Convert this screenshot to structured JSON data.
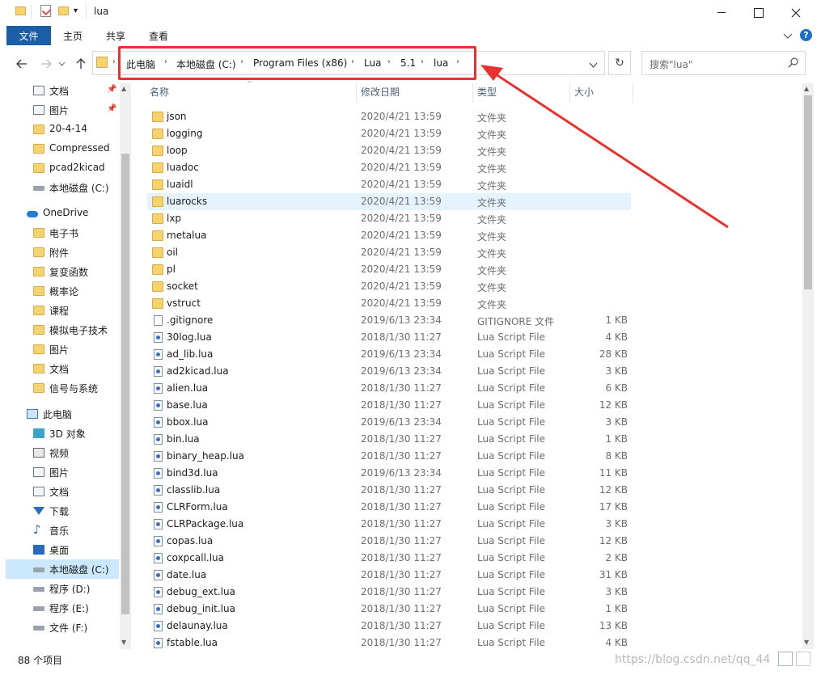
{
  "window": {
    "title": "lua",
    "qat_dropdown": "▾"
  },
  "ribbon": {
    "tabs": [
      "文件",
      "主页",
      "共享",
      "查看"
    ]
  },
  "address": {
    "crumbs": [
      "此电脑",
      "本地磁盘 (C:)",
      "Program Files (x86)",
      "Lua",
      "5.1",
      "lua"
    ]
  },
  "search": {
    "placeholder": "搜索\"lua\""
  },
  "nav": {
    "items": [
      {
        "label": "文档",
        "icon": "documents-icon",
        "pinned": true
      },
      {
        "label": "图片",
        "icon": "pictures-icon",
        "pinned": true
      },
      {
        "label": "20-4-14",
        "icon": "folder-icon"
      },
      {
        "label": "Compressed",
        "icon": "folder-icon"
      },
      {
        "label": "pcad2kicad",
        "icon": "folder-icon"
      },
      {
        "label": "本地磁盘 (C:)",
        "icon": "drive-icon"
      },
      {
        "label": "OneDrive",
        "icon": "cloud-icon"
      },
      {
        "label": "电子书",
        "icon": "folder-icon"
      },
      {
        "label": "附件",
        "icon": "folder-icon"
      },
      {
        "label": "复变函数",
        "icon": "folder-icon"
      },
      {
        "label": "概率论",
        "icon": "folder-icon"
      },
      {
        "label": "课程",
        "icon": "folder-icon"
      },
      {
        "label": "模拟电子技术",
        "icon": "folder-icon"
      },
      {
        "label": "图片",
        "icon": "folder-icon"
      },
      {
        "label": "文档",
        "icon": "folder-icon"
      },
      {
        "label": "信号与系统",
        "icon": "folder-icon"
      },
      {
        "label": "此电脑",
        "icon": "computer-icon"
      },
      {
        "label": "3D 对象",
        "icon": "3d-objects-icon"
      },
      {
        "label": "视频",
        "icon": "video-icon"
      },
      {
        "label": "图片",
        "icon": "pictures-icon"
      },
      {
        "label": "文档",
        "icon": "documents-icon"
      },
      {
        "label": "下载",
        "icon": "download-icon"
      },
      {
        "label": "音乐",
        "icon": "music-icon"
      },
      {
        "label": "桌面",
        "icon": "desktop-icon"
      },
      {
        "label": "本地磁盘 (C:)",
        "icon": "drive-icon",
        "selected": true
      },
      {
        "label": "程序 (D:)",
        "icon": "drive-icon"
      },
      {
        "label": "程序 (E:)",
        "icon": "drive-icon"
      },
      {
        "label": "文件 (F:)",
        "icon": "drive-icon"
      }
    ]
  },
  "columns": {
    "name": "名称",
    "date": "修改日期",
    "type": "类型",
    "size": "大小"
  },
  "files": [
    {
      "name": "json",
      "date": "2020/4/21 13:59",
      "type": "文件夹",
      "size": "",
      "kind": "folder"
    },
    {
      "name": "logging",
      "date": "2020/4/21 13:59",
      "type": "文件夹",
      "size": "",
      "kind": "folder"
    },
    {
      "name": "loop",
      "date": "2020/4/21 13:59",
      "type": "文件夹",
      "size": "",
      "kind": "folder"
    },
    {
      "name": "luadoc",
      "date": "2020/4/21 13:59",
      "type": "文件夹",
      "size": "",
      "kind": "folder"
    },
    {
      "name": "luaidl",
      "date": "2020/4/21 13:59",
      "type": "文件夹",
      "size": "",
      "kind": "folder"
    },
    {
      "name": "luarocks",
      "date": "2020/4/21 13:59",
      "type": "文件夹",
      "size": "",
      "kind": "folder",
      "selected": true
    },
    {
      "name": "lxp",
      "date": "2020/4/21 13:59",
      "type": "文件夹",
      "size": "",
      "kind": "folder"
    },
    {
      "name": "metalua",
      "date": "2020/4/21 13:59",
      "type": "文件夹",
      "size": "",
      "kind": "folder"
    },
    {
      "name": "oil",
      "date": "2020/4/21 13:59",
      "type": "文件夹",
      "size": "",
      "kind": "folder"
    },
    {
      "name": "pl",
      "date": "2020/4/21 13:59",
      "type": "文件夹",
      "size": "",
      "kind": "folder"
    },
    {
      "name": "socket",
      "date": "2020/4/21 13:59",
      "type": "文件夹",
      "size": "",
      "kind": "folder"
    },
    {
      "name": "vstruct",
      "date": "2020/4/21 13:59",
      "type": "文件夹",
      "size": "",
      "kind": "folder"
    },
    {
      "name": ".gitignore",
      "date": "2019/6/13 23:34",
      "type": "GITIGNORE 文件",
      "size": "1 KB",
      "kind": "file"
    },
    {
      "name": "30log.lua",
      "date": "2018/1/30 11:27",
      "type": "Lua Script File",
      "size": "4 KB",
      "kind": "lua"
    },
    {
      "name": "ad_lib.lua",
      "date": "2019/6/13 23:34",
      "type": "Lua Script File",
      "size": "28 KB",
      "kind": "lua"
    },
    {
      "name": "ad2kicad.lua",
      "date": "2019/6/13 23:34",
      "type": "Lua Script File",
      "size": "3 KB",
      "kind": "lua"
    },
    {
      "name": "alien.lua",
      "date": "2018/1/30 11:27",
      "type": "Lua Script File",
      "size": "6 KB",
      "kind": "lua"
    },
    {
      "name": "base.lua",
      "date": "2018/1/30 11:27",
      "type": "Lua Script File",
      "size": "12 KB",
      "kind": "lua"
    },
    {
      "name": "bbox.lua",
      "date": "2019/6/13 23:34",
      "type": "Lua Script File",
      "size": "3 KB",
      "kind": "lua"
    },
    {
      "name": "bin.lua",
      "date": "2018/1/30 11:27",
      "type": "Lua Script File",
      "size": "1 KB",
      "kind": "lua"
    },
    {
      "name": "binary_heap.lua",
      "date": "2018/1/30 11:27",
      "type": "Lua Script File",
      "size": "8 KB",
      "kind": "lua"
    },
    {
      "name": "bind3d.lua",
      "date": "2019/6/13 23:34",
      "type": "Lua Script File",
      "size": "11 KB",
      "kind": "lua"
    },
    {
      "name": "classlib.lua",
      "date": "2018/1/30 11:27",
      "type": "Lua Script File",
      "size": "12 KB",
      "kind": "lua"
    },
    {
      "name": "CLRForm.lua",
      "date": "2018/1/30 11:27",
      "type": "Lua Script File",
      "size": "17 KB",
      "kind": "lua"
    },
    {
      "name": "CLRPackage.lua",
      "date": "2018/1/30 11:27",
      "type": "Lua Script File",
      "size": "3 KB",
      "kind": "lua"
    },
    {
      "name": "copas.lua",
      "date": "2018/1/30 11:27",
      "type": "Lua Script File",
      "size": "12 KB",
      "kind": "lua"
    },
    {
      "name": "coxpcall.lua",
      "date": "2018/1/30 11:27",
      "type": "Lua Script File",
      "size": "2 KB",
      "kind": "lua"
    },
    {
      "name": "date.lua",
      "date": "2018/1/30 11:27",
      "type": "Lua Script File",
      "size": "31 KB",
      "kind": "lua"
    },
    {
      "name": "debug_ext.lua",
      "date": "2018/1/30 11:27",
      "type": "Lua Script File",
      "size": "3 KB",
      "kind": "lua"
    },
    {
      "name": "debug_init.lua",
      "date": "2018/1/30 11:27",
      "type": "Lua Script File",
      "size": "1 KB",
      "kind": "lua"
    },
    {
      "name": "delaunay.lua",
      "date": "2018/1/30 11:27",
      "type": "Lua Script File",
      "size": "13 KB",
      "kind": "lua"
    },
    {
      "name": "fstable.lua",
      "date": "2018/1/30 11:27",
      "type": "Lua Script File",
      "size": "4 KB",
      "kind": "lua"
    }
  ],
  "status": {
    "count": "88 个项目",
    "watermark": "https://blog.csdn.net/qq_44"
  },
  "colors": {
    "accent": "#1a5ea8",
    "highlight": "#e8322f",
    "folder": "#f7d36b",
    "selection": "#cce8ff"
  }
}
